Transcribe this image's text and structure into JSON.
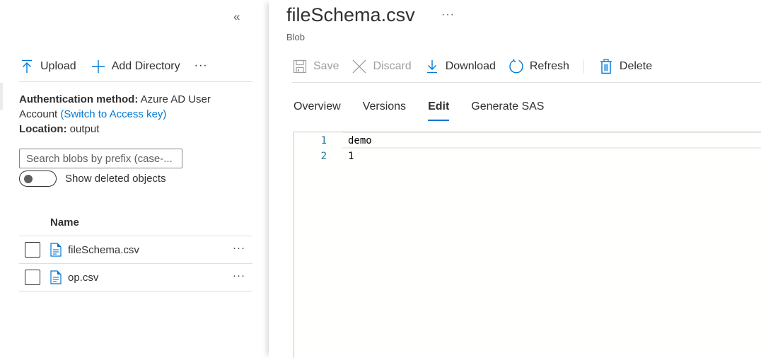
{
  "left_pane": {
    "collapse_icon": "double-chevron-left",
    "toolbar": {
      "upload_label": "Upload",
      "add_directory_label": "Add Directory",
      "more_label": "···"
    },
    "auth": {
      "method_label": "Authentication method:",
      "method_value_line1": "Azure AD User",
      "method_value_line2": "Account",
      "switch_link": "(Switch to Access key)",
      "location_label": "Location:",
      "location_value": "output"
    },
    "search": {
      "placeholder": "Search blobs by prefix (case-...",
      "value": ""
    },
    "show_deleted": {
      "label": "Show deleted objects",
      "enabled": false
    },
    "list": {
      "column_name": "Name",
      "items": [
        {
          "name": "fileSchema.csv",
          "selected": false,
          "more": "···"
        },
        {
          "name": "op.csv",
          "selected": false,
          "more": "···"
        }
      ]
    }
  },
  "right_pane": {
    "title": "fileSchema.csv",
    "title_more": "···",
    "subtitle": "Blob",
    "toolbar": {
      "save_label": "Save",
      "discard_label": "Discard",
      "download_label": "Download",
      "refresh_label": "Refresh",
      "delete_label": "Delete"
    },
    "tabs": [
      {
        "label": "Overview",
        "active": false
      },
      {
        "label": "Versions",
        "active": false
      },
      {
        "label": "Edit",
        "active": true
      },
      {
        "label": "Generate SAS",
        "active": false
      }
    ],
    "editor": {
      "lines": [
        {
          "number": "1",
          "text": "demo"
        },
        {
          "number": "2",
          "text": "1"
        }
      ]
    }
  },
  "colors": {
    "accent": "#0078d4",
    "text": "#323130",
    "disabled": "#a19f9d",
    "line_number": "#237893"
  }
}
